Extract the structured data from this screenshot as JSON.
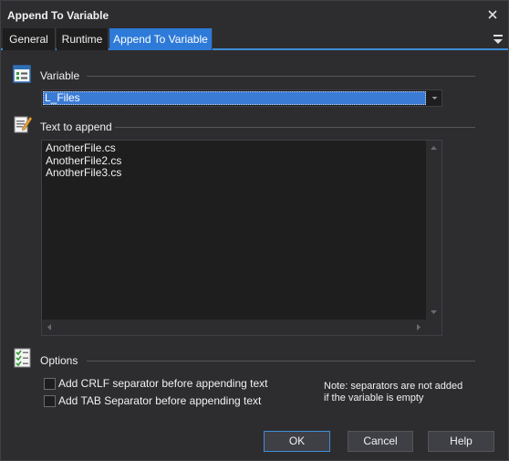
{
  "window": {
    "title": "Append To Variable"
  },
  "tabs": [
    {
      "label": "General"
    },
    {
      "label": "Runtime"
    },
    {
      "label": "Append To Variable"
    }
  ],
  "variable_section": {
    "label": "Variable",
    "selected_value": "L_Files"
  },
  "text_section": {
    "label": "Text to append",
    "lines": [
      "AnotherFile.cs",
      "AnotherFile2.cs",
      "AnotherFile3.cs"
    ]
  },
  "options_section": {
    "label": "Options",
    "options": [
      {
        "label": "Add CRLF separator before appending text",
        "checked": false
      },
      {
        "label": "Add TAB Separator before appending text",
        "checked": false
      }
    ],
    "note_line1": "Note: separators are not added",
    "note_line2": "if the variable is empty"
  },
  "buttons": {
    "ok": "OK",
    "cancel": "Cancel",
    "help": "Help"
  },
  "colors": {
    "background": "#2d2d30",
    "input_background": "#1e1e1e",
    "accent": "#2d7ad8",
    "text": "#f1f1f1"
  },
  "icons": {
    "variable": "variable-list-icon",
    "text": "edit-text-icon",
    "options": "options-checklist-icon"
  }
}
